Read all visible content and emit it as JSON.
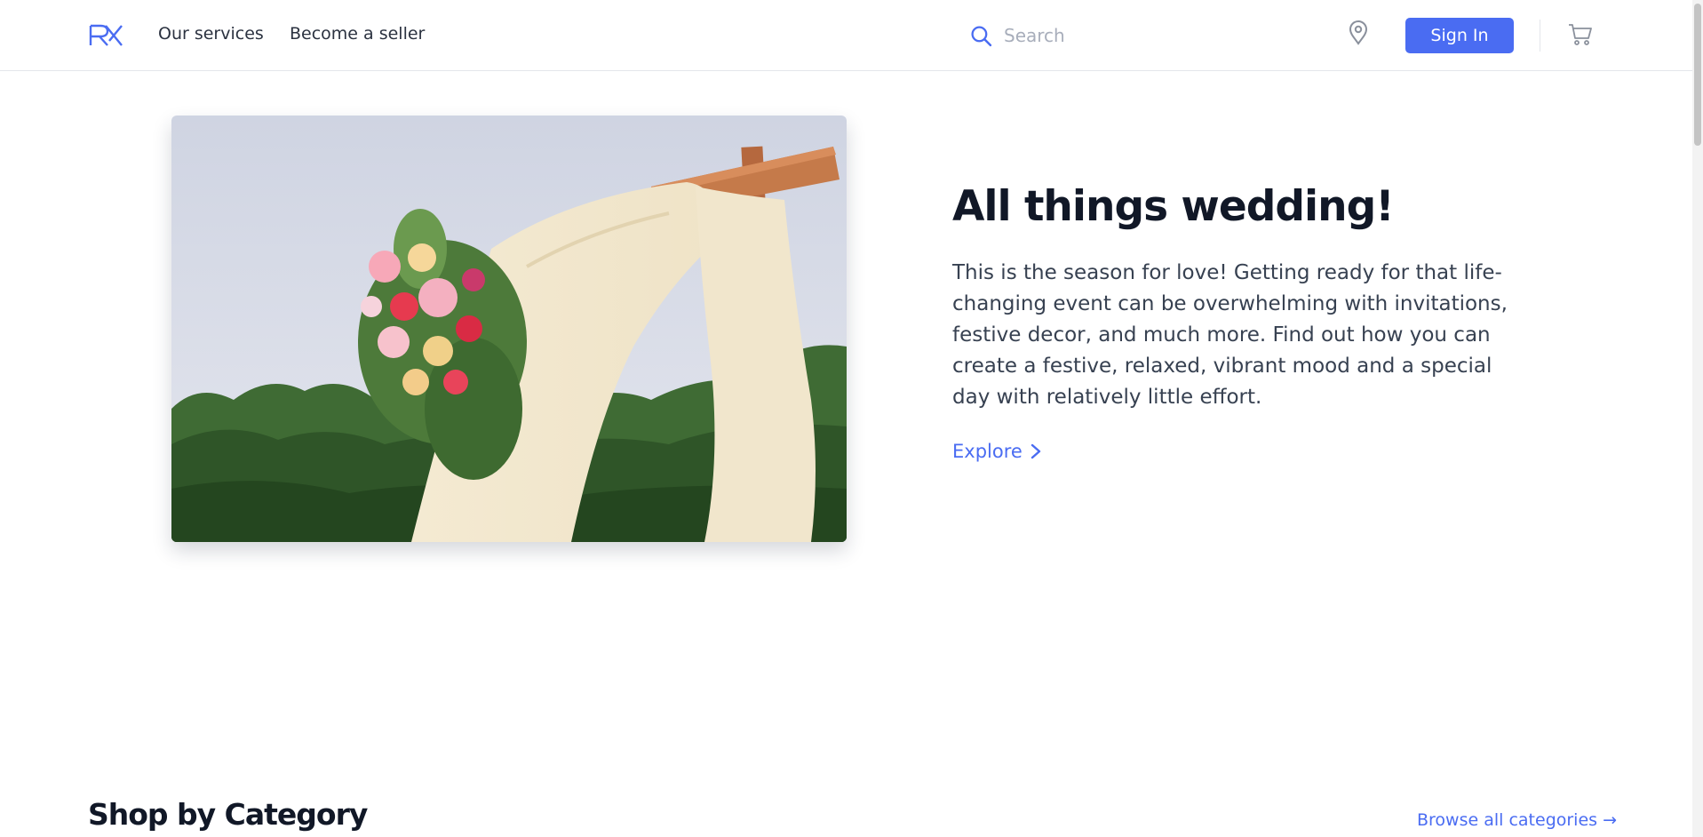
{
  "header": {
    "logo_text": "RX",
    "nav": [
      {
        "label": "Our services"
      },
      {
        "label": "Become a seller"
      }
    ],
    "search": {
      "placeholder": "Search",
      "value": ""
    },
    "signin_label": "Sign In",
    "icons": {
      "search": "search-icon",
      "location": "map-pin-icon",
      "cart": "shopping-cart-icon"
    }
  },
  "hero": {
    "title": "All things wedding!",
    "text": "This is the season for love! Getting ready for that life-changing event can be overwhelming with invitations, festive decor, and much more. Find out how you can create a festive, relaxed, vibrant mood and a special day with relatively little effort.",
    "cta_label": "Explore"
  },
  "categories": {
    "title": "Shop by Category",
    "browse_label": "Browse all categories →"
  },
  "colors": {
    "accent": "#4a6cf2",
    "heading": "#111827",
    "body_text": "#374151"
  }
}
